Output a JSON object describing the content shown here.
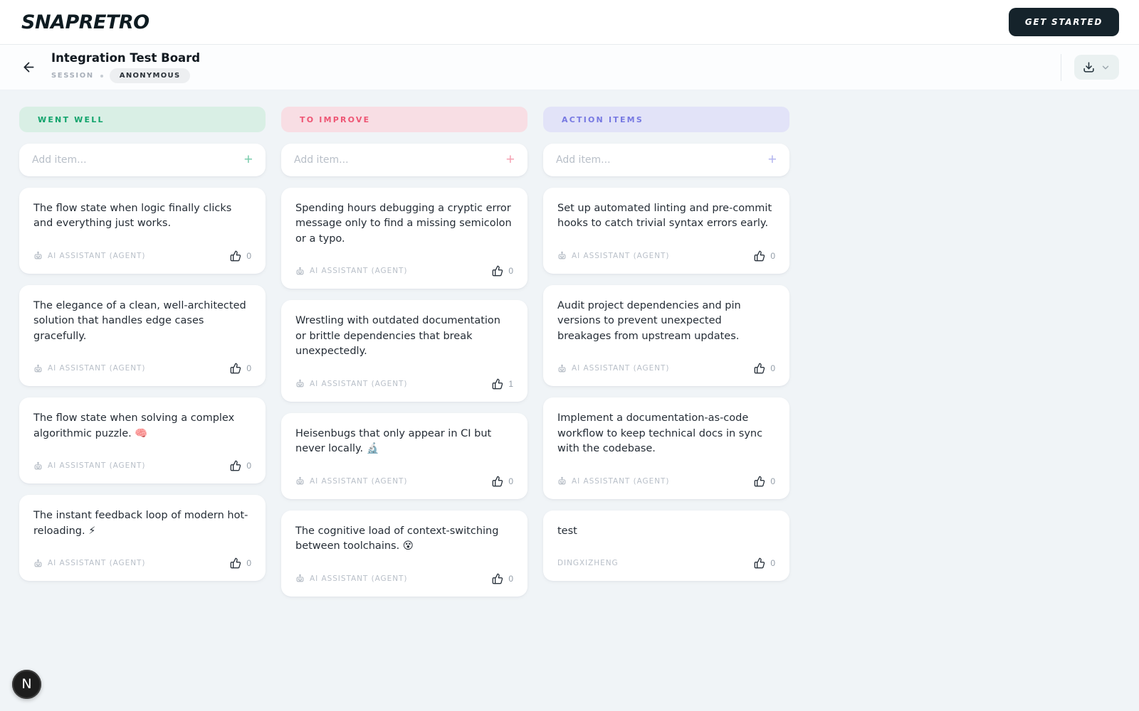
{
  "navbar": {
    "logo": "SNAPRETRO",
    "get_started_label": "GET STARTED"
  },
  "board_header": {
    "title": "Integration Test Board",
    "session_label": "SESSION",
    "visibility_badge": "ANONYMOUS"
  },
  "columns": [
    {
      "id": "went-well",
      "title": "WENT WELL",
      "accent": "#0fa36b",
      "header_bg": "#d9efe5",
      "add_placeholder": "Add item...",
      "add_value": "",
      "cards": [
        {
          "text": "The flow state when logic finally clicks and everything just works.",
          "author": "AI ASSISTANT (AGENT)",
          "is_agent": true,
          "votes": 0
        },
        {
          "text": "The elegance of a clean, well-architected solution that handles edge cases gracefully.",
          "author": "AI ASSISTANT (AGENT)",
          "is_agent": true,
          "votes": 0
        },
        {
          "text": "The flow state when solving a complex algorithmic puzzle. 🧠",
          "author": "AI ASSISTANT (AGENT)",
          "is_agent": true,
          "votes": 0
        },
        {
          "text": "The instant feedback loop of modern hot-reloading. ⚡",
          "author": "AI ASSISTANT (AGENT)",
          "is_agent": true,
          "votes": 0
        }
      ]
    },
    {
      "id": "to-improve",
      "title": "TO IMPROVE",
      "accent": "#ee5674",
      "header_bg": "#f8dee4",
      "add_placeholder": "Add item...",
      "add_value": "",
      "cards": [
        {
          "text": "Spending hours debugging a cryptic error message only to find a missing semicolon or a typo.",
          "author": "AI ASSISTANT (AGENT)",
          "is_agent": true,
          "votes": 0
        },
        {
          "text": "Wrestling with outdated documentation or brittle dependencies that break unexpectedly.",
          "author": "AI ASSISTANT (AGENT)",
          "is_agent": true,
          "votes": 1
        },
        {
          "text": "Heisenbugs that only appear in CI but never locally. 🔬",
          "author": "AI ASSISTANT (AGENT)",
          "is_agent": true,
          "votes": 0
        },
        {
          "text": "The cognitive load of context-switching between toolchains. 😵",
          "author": "AI ASSISTANT (AGENT)",
          "is_agent": true,
          "votes": 0
        }
      ]
    },
    {
      "id": "action-items",
      "title": "ACTION ITEMS",
      "accent": "#7779e2",
      "header_bg": "#e2e3f8",
      "add_placeholder": "Add item...",
      "add_value": "",
      "cards": [
        {
          "text": "Set up automated linting and pre-commit hooks to catch trivial syntax errors early.",
          "author": "AI ASSISTANT (AGENT)",
          "is_agent": true,
          "votes": 0
        },
        {
          "text": "Audit project dependencies and pin versions to prevent unexpected breakages from upstream updates.",
          "author": "AI ASSISTANT (AGENT)",
          "is_agent": true,
          "votes": 0
        },
        {
          "text": "Implement a documentation-as-code workflow to keep technical docs in sync with the codebase.",
          "author": "AI ASSISTANT (AGENT)",
          "is_agent": true,
          "votes": 0
        },
        {
          "text": "test",
          "author": "DINGXIZHENG",
          "is_agent": false,
          "votes": 0
        }
      ]
    }
  ],
  "dev_badge": {
    "label": "N"
  }
}
